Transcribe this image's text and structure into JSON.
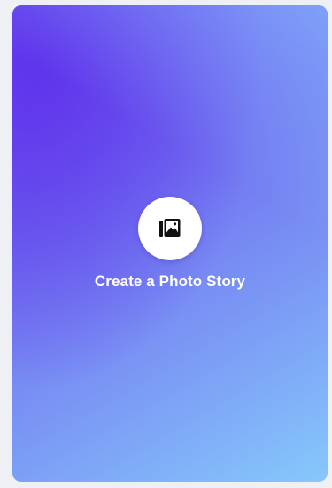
{
  "card": {
    "label": "Create a Photo Story",
    "icon": "photo-stack-icon",
    "gradient_colors": [
      "#5f32eb",
      "#7a95f4",
      "#86c8fb"
    ],
    "icon_background": "#ffffff",
    "icon_color": "#111111",
    "text_color": "#ffffff"
  }
}
